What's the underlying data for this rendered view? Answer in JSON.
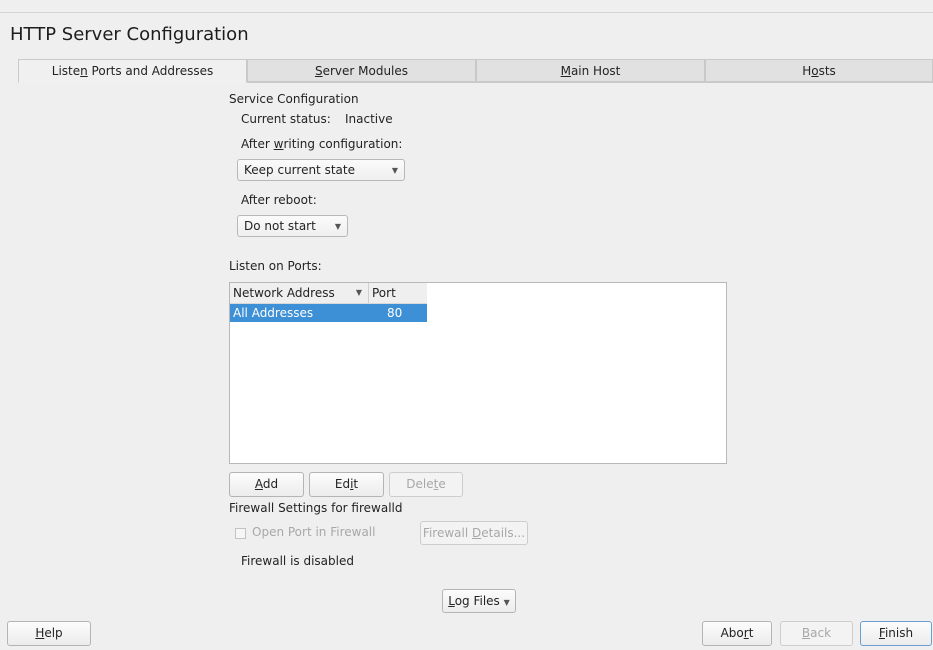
{
  "window": {
    "title": "HTTP Server Configuration"
  },
  "tabs": [
    {
      "pre": "Liste",
      "mn": "n",
      "post": " Ports and Addresses"
    },
    {
      "pre": "",
      "mn": "S",
      "post": "erver Modules"
    },
    {
      "pre": "",
      "mn": "M",
      "post": "ain Host"
    },
    {
      "pre": "H",
      "mn": "o",
      "post": "sts"
    }
  ],
  "service": {
    "section_title": "Service Configuration",
    "status_label": "Current status:",
    "status_value": "Inactive",
    "after_writing_pre": "After ",
    "after_writing_mn": "w",
    "after_writing_post": "riting configuration:",
    "after_writing_value": "Keep current state",
    "after_reboot_label": "After reboot:",
    "after_reboot_value": "Do not start"
  },
  "ports": {
    "label": "Listen on Ports:",
    "columns": [
      "Network Address",
      "Port"
    ],
    "rows": [
      {
        "address": "All Addresses",
        "port": "80"
      }
    ]
  },
  "port_buttons": {
    "add_pre": "",
    "add_mn": "A",
    "add_post": "dd",
    "edit_pre": "Ed",
    "edit_mn": "i",
    "edit_post": "t",
    "delete_pre": "Dele",
    "delete_mn": "t",
    "delete_post": "e"
  },
  "firewall": {
    "title": "Firewall Settings for firewalld",
    "open_port_label": "Open Port in Firewall",
    "details_pre": "Firewall ",
    "details_mn": "D",
    "details_post": "etails...",
    "status": "Firewall is disabled"
  },
  "log_files": {
    "pre": "",
    "mn": "L",
    "post": "og Files"
  },
  "footer": {
    "help_pre": "",
    "help_mn": "H",
    "help_post": "elp",
    "abort_pre": "Abo",
    "abort_mn": "r",
    "abort_post": "t",
    "back_pre": "",
    "back_mn": "B",
    "back_post": "ack",
    "finish_pre": "",
    "finish_mn": "F",
    "finish_post": "inish"
  }
}
